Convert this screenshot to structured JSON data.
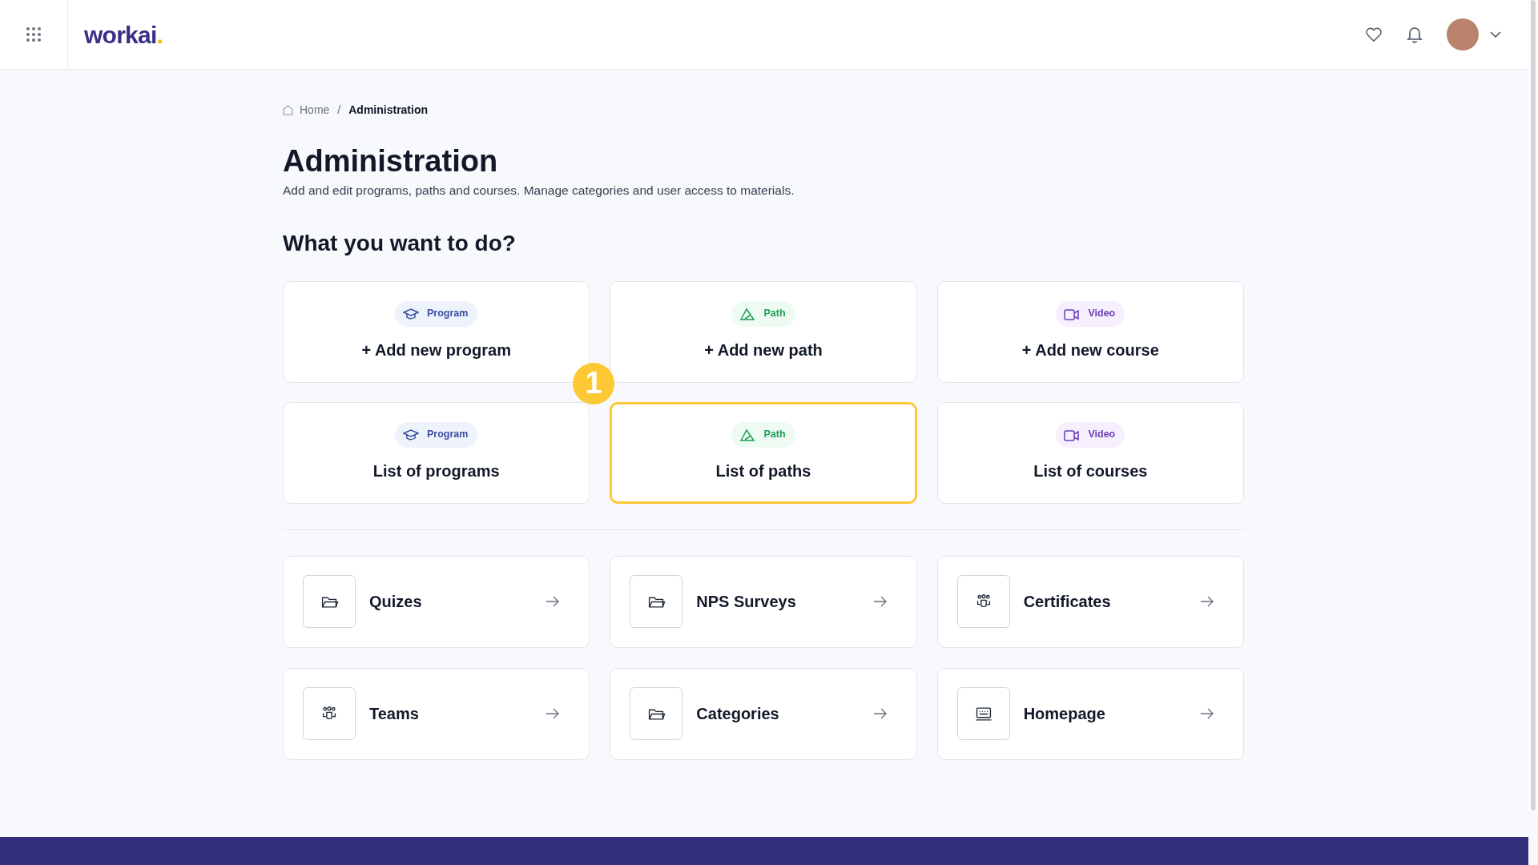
{
  "header": {
    "logo": "workai",
    "logo_dot": "."
  },
  "breadcrumb": [
    "Home",
    "Administration"
  ],
  "breadcrumb_separator": "/",
  "page": {
    "title": "Administration",
    "description": "Add and edit programs, paths and courses. Manage categories and user access to materials."
  },
  "section_title": "What you want to do?",
  "action_cards": [
    {
      "kind": "program",
      "tag": "Program",
      "label": "+ Add new program",
      "selected": false
    },
    {
      "kind": "path",
      "tag": "Path",
      "label": "+ Add new path",
      "selected": false
    },
    {
      "kind": "video",
      "tag": "Video",
      "label": "+ Add new course",
      "selected": false
    },
    {
      "kind": "program",
      "tag": "Program",
      "label": "List of programs",
      "selected": false
    },
    {
      "kind": "path",
      "tag": "Path",
      "label": "List of paths",
      "selected": true
    },
    {
      "kind": "video",
      "tag": "Video",
      "label": "List of courses",
      "selected": false
    }
  ],
  "callout": "1",
  "link_cards": [
    {
      "kind": "folder",
      "label": "Quizes"
    },
    {
      "kind": "folder",
      "label": "NPS Surveys"
    },
    {
      "kind": "people",
      "label": "Certificates"
    },
    {
      "kind": "people",
      "label": "Teams"
    },
    {
      "kind": "folder",
      "label": "Categories"
    },
    {
      "kind": "screen",
      "label": "Homepage"
    }
  ]
}
